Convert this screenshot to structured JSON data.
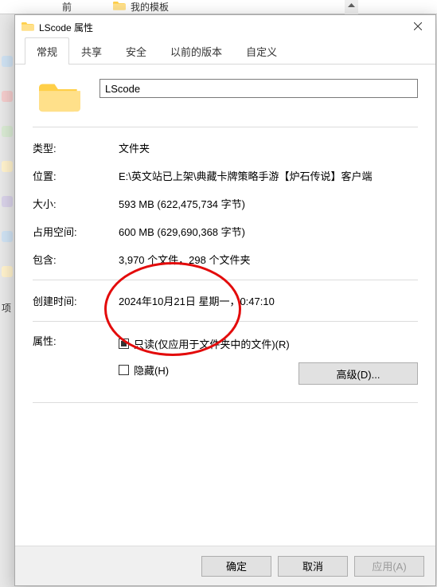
{
  "background": {
    "prev_item": "前",
    "tree_item": "我的模板",
    "option_label": "项"
  },
  "dialog": {
    "title": "LScode 属性",
    "name_value": "LScode",
    "tabs": {
      "general": "常规",
      "sharing": "共享",
      "security": "安全",
      "previous": "以前的版本",
      "custom": "自定义"
    },
    "rows": {
      "type_label": "类型:",
      "type_value": "文件夹",
      "location_label": "位置:",
      "location_value": "E:\\英文站已上架\\典藏卡牌策略手游【炉石传说】客户端",
      "size_label": "大小:",
      "size_value": "593 MB (622,475,734 字节)",
      "ondisk_label": "占用空间:",
      "ondisk_value": "600 MB (629,690,368 字节)",
      "contains_label": "包含:",
      "contains_value": "3,970 个文件，298 个文件夹",
      "created_label": "创建时间:",
      "created_value": "2024年10月21日 星期一，0:47:10",
      "attr_label": "属性:",
      "readonly_label": "只读(仅应用于文件夹中的文件)(R)",
      "hidden_label": "隐藏(H)",
      "advanced_label": "高级(D)..."
    },
    "buttons": {
      "ok": "确定",
      "cancel": "取消",
      "apply": "应用(A)"
    }
  }
}
